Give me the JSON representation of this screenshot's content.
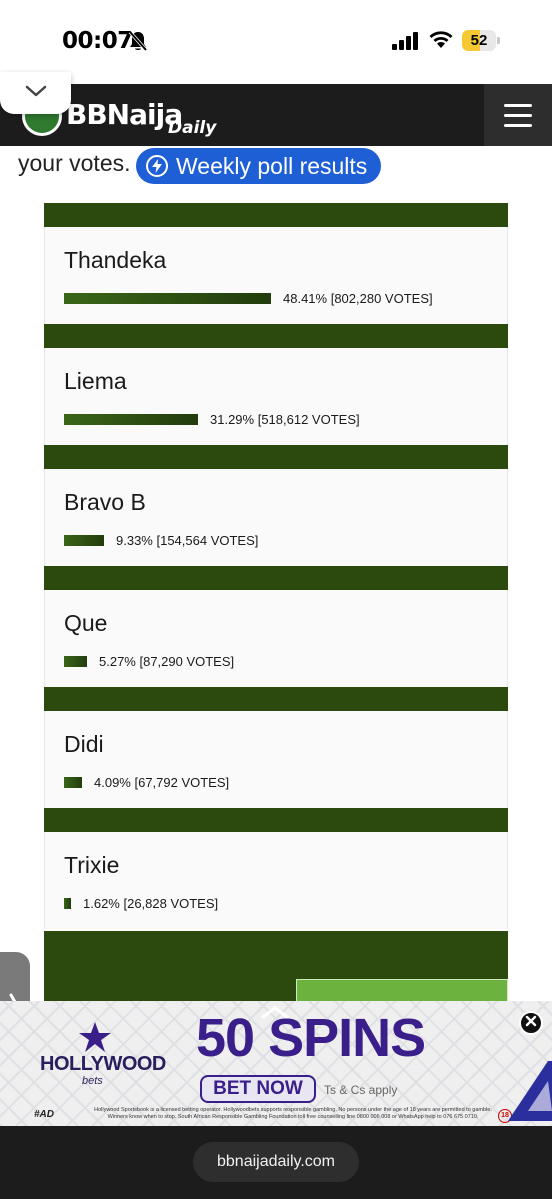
{
  "status_bar": {
    "time": "00:07",
    "battery_level": "52",
    "battery_fraction": 0.52
  },
  "header": {
    "logo_text": "BBNaija",
    "logo_sub": "Daily",
    "menu_icon": "hamburger-icon",
    "collapse_icon": "chevron-down-icon"
  },
  "intro": {
    "text": "your votes.",
    "button_label": "Weekly poll results",
    "button_icon": "lightning-icon"
  },
  "poll": {
    "bar_color": "#2c4a0e",
    "items": [
      {
        "name": "Thandeka",
        "percent": 48.41,
        "result": "48.41% [802,280 VOTES]"
      },
      {
        "name": "Liema",
        "percent": 31.29,
        "result": "31.29% [518,612 VOTES]"
      },
      {
        "name": "Bravo B",
        "percent": 9.33,
        "result": "9.33% [154,564 VOTES]"
      },
      {
        "name": "Que",
        "percent": 5.27,
        "result": "5.27% [87,290 VOTES]"
      },
      {
        "name": "Didi",
        "percent": 4.09,
        "result": "4.09% [67,792 VOTES]"
      },
      {
        "name": "Trixie",
        "percent": 1.62,
        "result": "1.62% [26,828 VOTES]"
      }
    ]
  },
  "ad": {
    "brand": "HOLLYWOOD",
    "brand_sub": "bets",
    "headline": "50 SPINS",
    "cta": "BET NOW",
    "terms": "Ts & Cs apply",
    "tag": "#AD",
    "legal": "Hollywood Sportsbook is a licensed betting operator. Hollywoodbets supports responsible gambling. No persons under the age of 18 years are permitted to gamble. Winners know when to stop. South African Responsible Gambling Foundation toll free counselling line 0800 006 008 or WhatsApp help to 076 675 0710.",
    "age": "18",
    "close_icon": "close-icon"
  },
  "browser": {
    "url": "bbnaijadaily.com"
  }
}
